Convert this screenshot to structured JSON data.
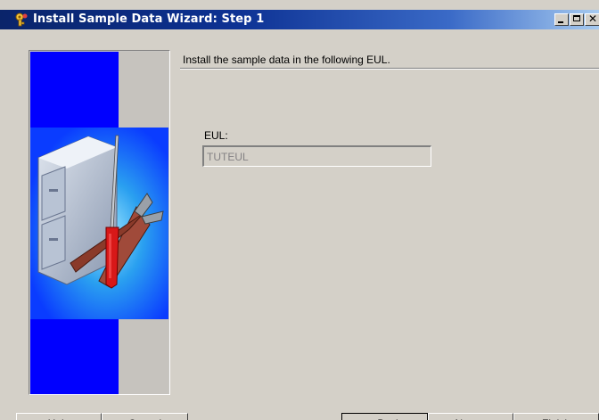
{
  "window": {
    "title": "Install Sample Data Wizard: Step 1",
    "icon": "wizard-key-icon",
    "controls": {
      "minimize": "minimize-icon",
      "maximize": "maximize-icon",
      "close": "close-icon"
    }
  },
  "main": {
    "instruction": "Install the sample data in the following EUL.",
    "eul_label": "EUL:",
    "eul_value": "TUTEUL"
  },
  "illustration": {
    "name": "file-cabinet-tools-illustration",
    "colors": {
      "band": "#0000ff",
      "side": "#c6c3be"
    }
  },
  "buttons": {
    "help": "Help",
    "cancel": "Cancel",
    "back": "< Back",
    "next": "Next >",
    "finish": "Finish"
  }
}
